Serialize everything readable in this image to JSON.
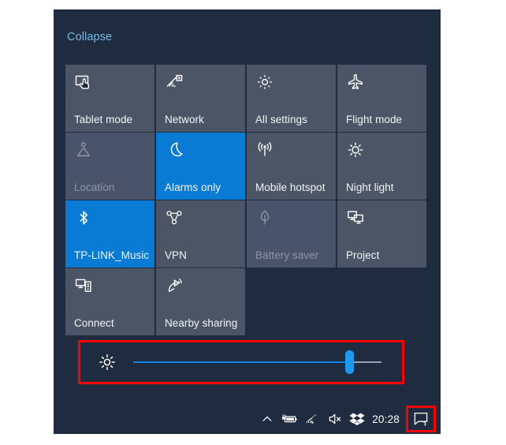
{
  "panel": {
    "collapse_label": "Collapse",
    "background_color": "#1f2b3e",
    "tile_color_inactive": "#4c5566",
    "tile_color_active": "#0a7bd4",
    "tile_color_disabled": "#49536a",
    "link_color": "#7ab7e8"
  },
  "tiles": [
    {
      "label": "Tablet mode",
      "icon": "tablet-mode-icon",
      "state": "inactive"
    },
    {
      "label": "Network",
      "icon": "network-icon",
      "state": "inactive"
    },
    {
      "label": "All settings",
      "icon": "gear-icon",
      "state": "inactive"
    },
    {
      "label": "Flight mode",
      "icon": "airplane-icon",
      "state": "inactive"
    },
    {
      "label": "Location",
      "icon": "location-person-icon",
      "state": "disabled"
    },
    {
      "label": "Alarms only",
      "icon": "moon-icon",
      "state": "active"
    },
    {
      "label": "Mobile hotspot",
      "icon": "hotspot-icon",
      "state": "inactive"
    },
    {
      "label": "Night light",
      "icon": "sun-icon",
      "state": "inactive"
    },
    {
      "label": "TP-LINK_Music",
      "icon": "bluetooth-icon",
      "state": "active"
    },
    {
      "label": "VPN",
      "icon": "vpn-nodes-icon",
      "state": "inactive"
    },
    {
      "label": "Battery saver",
      "icon": "leaf-icon",
      "state": "disabled"
    },
    {
      "label": "Project",
      "icon": "project-screens-icon",
      "state": "inactive"
    },
    {
      "label": "Connect",
      "icon": "connect-devices-icon",
      "state": "inactive"
    },
    {
      "label": "Nearby sharing",
      "icon": "nearby-sharing-icon",
      "state": "inactive"
    }
  ],
  "brightness": {
    "icon": "brightness-sun-icon",
    "value_percent": 87,
    "track_color": "#9aa0ac",
    "fill_color": "#1283e0",
    "thumb_color": "#1b9af0",
    "highlight_color": "#fe0000"
  },
  "taskbar": {
    "clock": "20:28",
    "tray_icons": [
      {
        "name": "chevron-up-icon",
        "label": "Show hidden icons"
      },
      {
        "name": "battery-charging-icon",
        "label": "Battery charging"
      },
      {
        "name": "wifi-icon",
        "label": "Network"
      },
      {
        "name": "volume-muted-icon",
        "label": "Volume muted"
      },
      {
        "name": "dropbox-icon",
        "label": "Dropbox"
      }
    ],
    "action_center_icon": "action-center-icon",
    "action_center_highlight_color": "#fe0000"
  }
}
